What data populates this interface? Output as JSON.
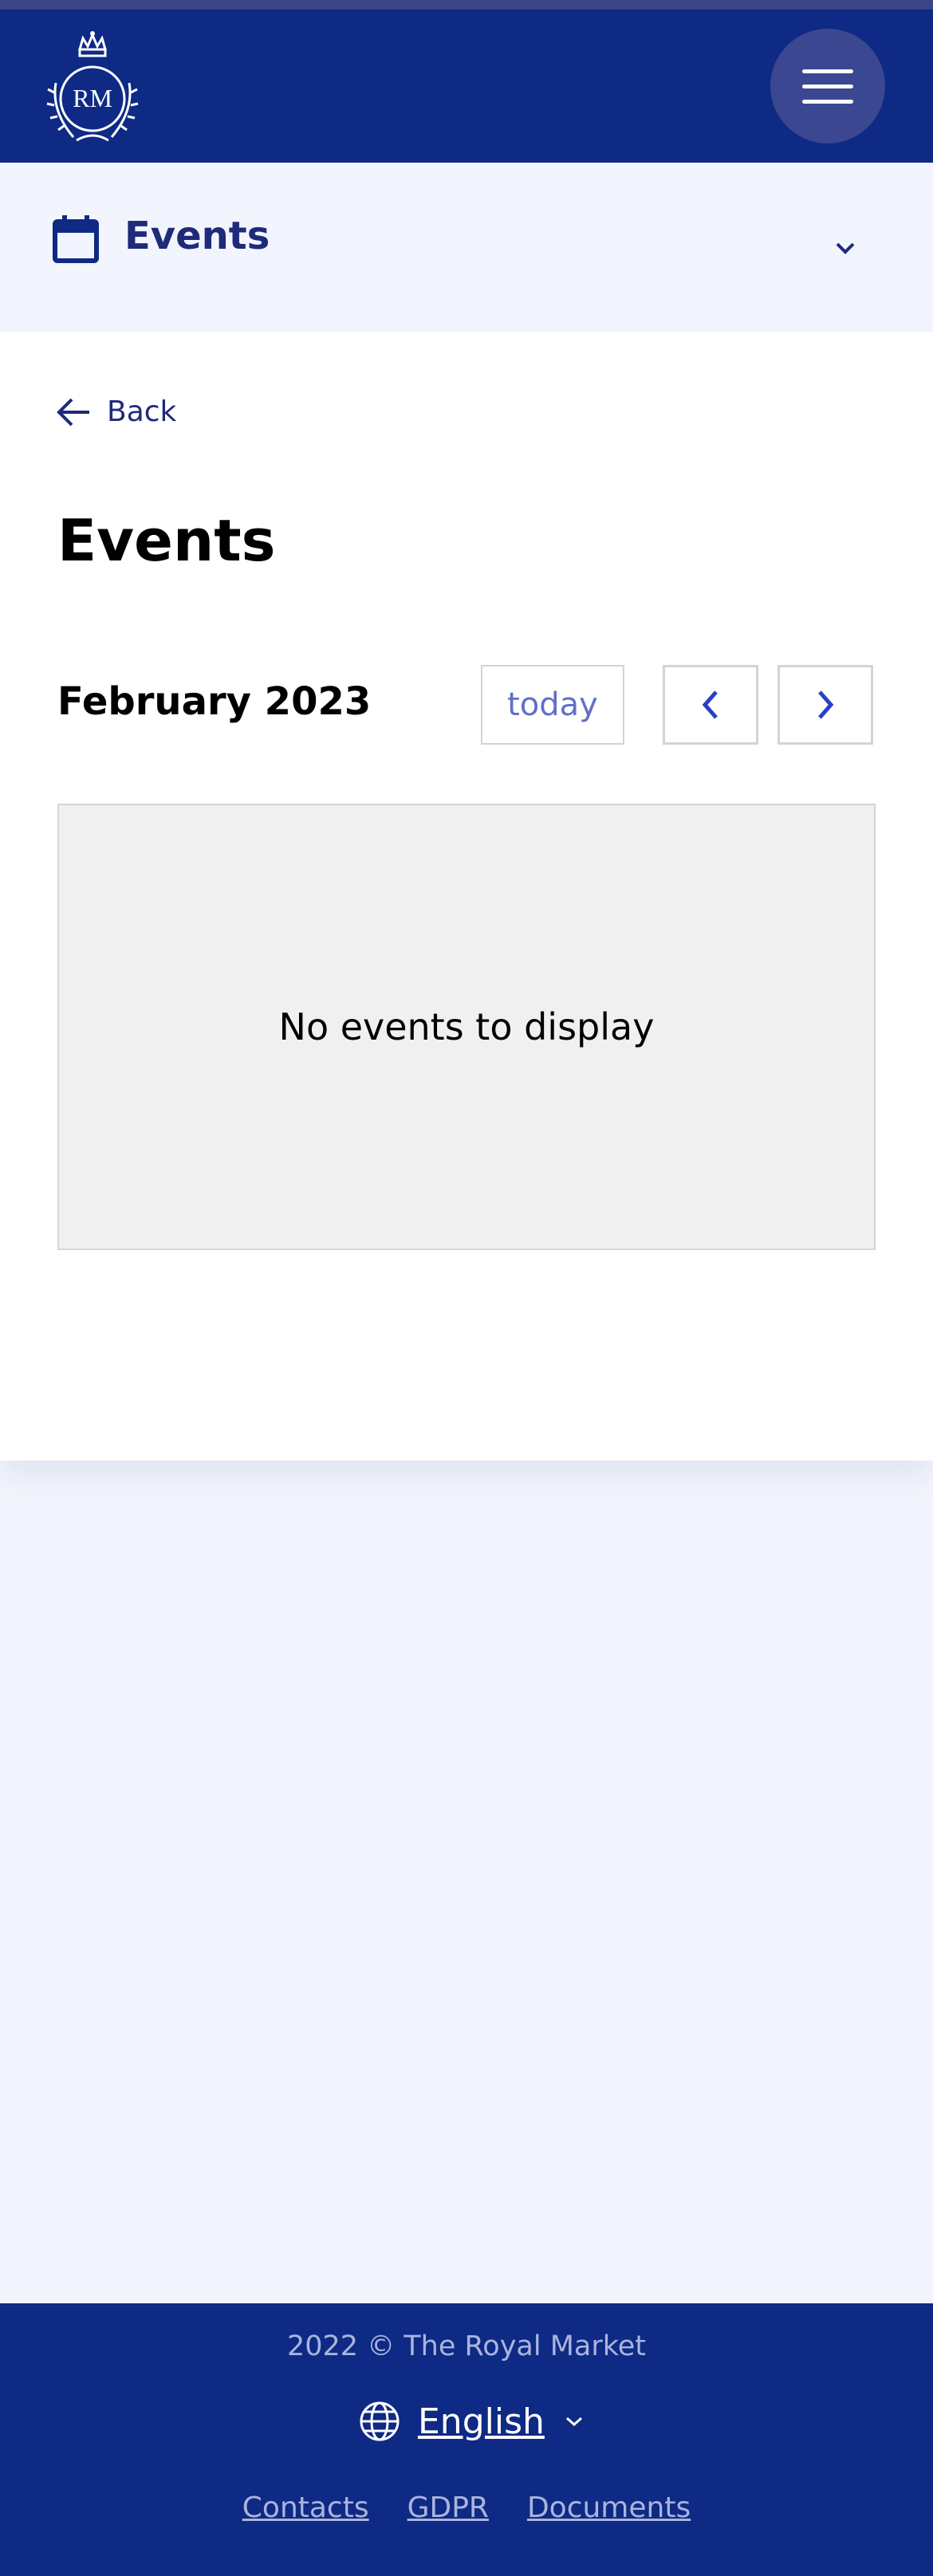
{
  "header": {
    "logo_text": "RM",
    "menu_icon": "hamburger-icon"
  },
  "section_bar": {
    "title": "Events",
    "icon": "calendar-icon",
    "toggle_icon": "chevron-down-icon"
  },
  "content": {
    "back_label": "Back",
    "page_title": "Events",
    "calendar": {
      "month_label": "February 2023",
      "today_label": "today",
      "prev_icon": "chevron-left-icon",
      "next_icon": "chevron-right-icon",
      "empty_message": "No events to display"
    }
  },
  "footer": {
    "copyright": "2022 © The Royal Market",
    "language": "English",
    "links": [
      "Contacts",
      "GDPR",
      "Documents"
    ]
  },
  "colors": {
    "brand_navy": "#0e2a85",
    "page_bg": "#f2f5fd",
    "accent_text": "#1f2a7a",
    "nav_arrow": "#2a3fc8"
  }
}
